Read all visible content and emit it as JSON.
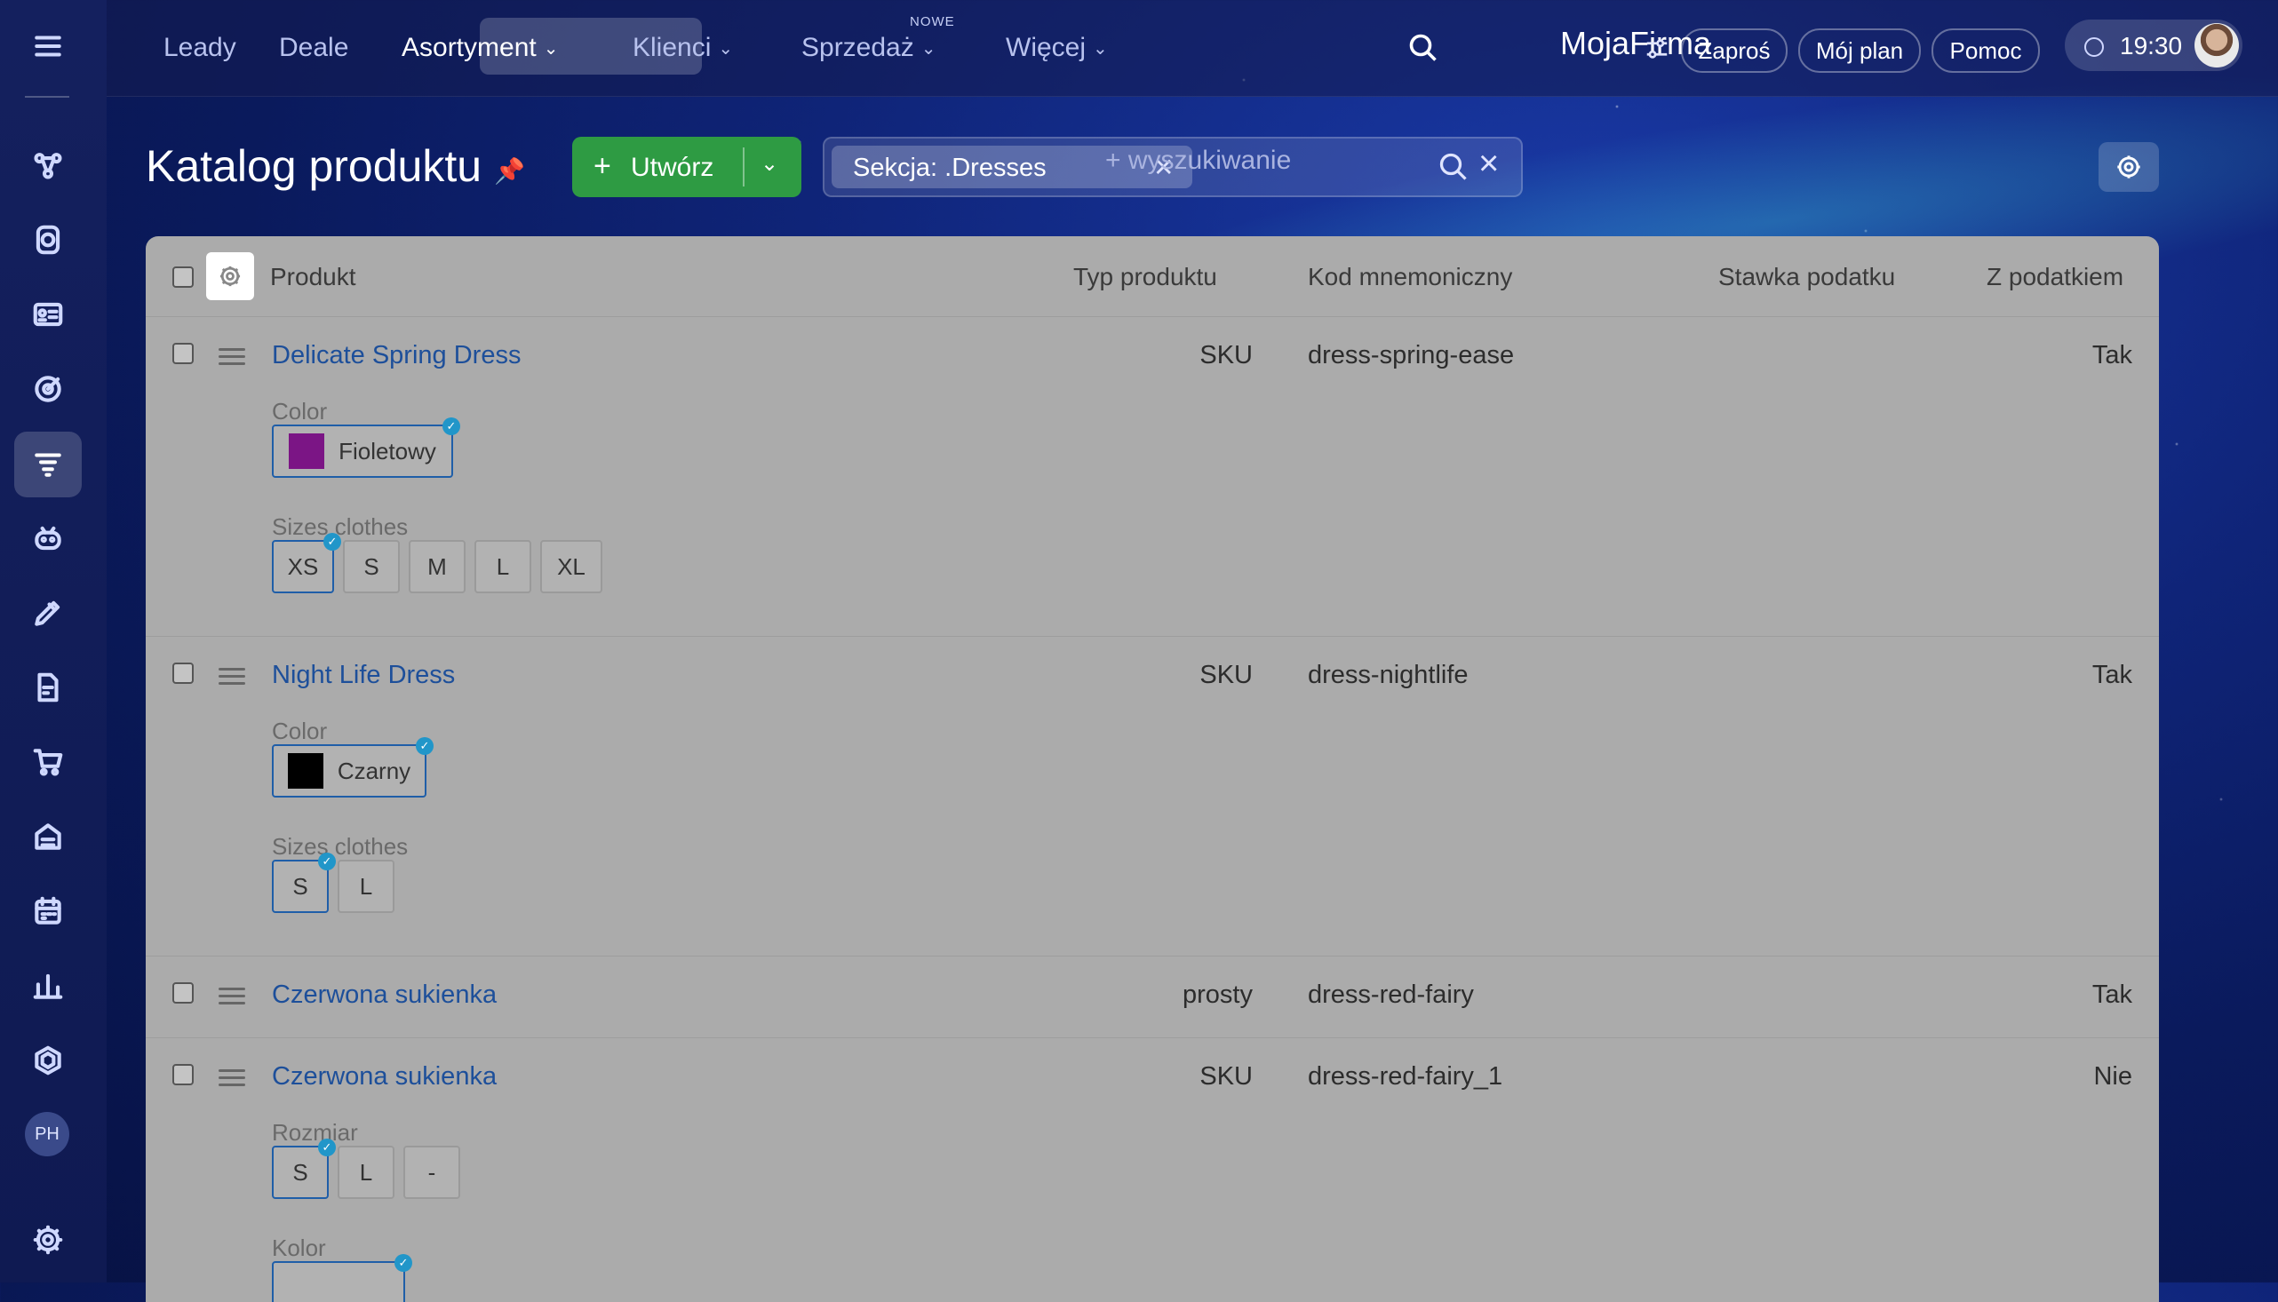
{
  "nav": {
    "items": [
      "Leady",
      "Deale",
      "Asortyment",
      "Klienci",
      "Sprzedaż",
      "Więcej"
    ],
    "badge_new": "NOWE"
  },
  "brand": "MojaFirma",
  "header_buttons": {
    "invite": "Zaproś",
    "my_plan": "Mój plan",
    "help": "Pomoc"
  },
  "clock": "19:30",
  "user_initials": "PH",
  "page": {
    "title": "Katalog produktu",
    "create_label": "Utwórz"
  },
  "search": {
    "chip": "Sekcja: .Dresses",
    "placeholder": "+ wyszukiwanie"
  },
  "table": {
    "headers": {
      "product": "Produkt",
      "type": "Typ produktu",
      "code": "Kod mnemoniczny",
      "tax_rate": "Stawka podatku",
      "with_tax": "Z podatkiem"
    },
    "rows": [
      {
        "name": "Delicate Spring Dress",
        "type": "SKU",
        "code": "dress-spring-ease",
        "tax": "Tak",
        "color_label": "Color",
        "color_value": "Fioletowy",
        "color_hex": "#7b1585",
        "size_label": "Sizes clothes",
        "sizes": [
          "XS",
          "S",
          "M",
          "L",
          "XL"
        ],
        "size_selected": "XS"
      },
      {
        "name": "Night Life Dress",
        "type": "SKU",
        "code": "dress-nightlife",
        "tax": "Tak",
        "color_label": "Color",
        "color_value": "Czarny",
        "color_hex": "#000000",
        "size_label": "Sizes clothes",
        "sizes": [
          "S",
          "L"
        ],
        "size_selected": "S"
      },
      {
        "name": "Czerwona sukienka",
        "type": "prosty",
        "code": "dress-red-fairy",
        "tax": "Tak"
      },
      {
        "name": "Czerwona sukienka",
        "type": "SKU",
        "code": "dress-red-fairy_1",
        "tax": "Nie",
        "size_label": "Rozmiar",
        "sizes": [
          "S",
          "L",
          "-"
        ],
        "size_selected": "S",
        "color_label": "Kolor"
      }
    ]
  },
  "colors": {
    "accent_green": "#2e9b43",
    "link_blue": "#1d4f9a",
    "check_blue": "#2196c9"
  }
}
